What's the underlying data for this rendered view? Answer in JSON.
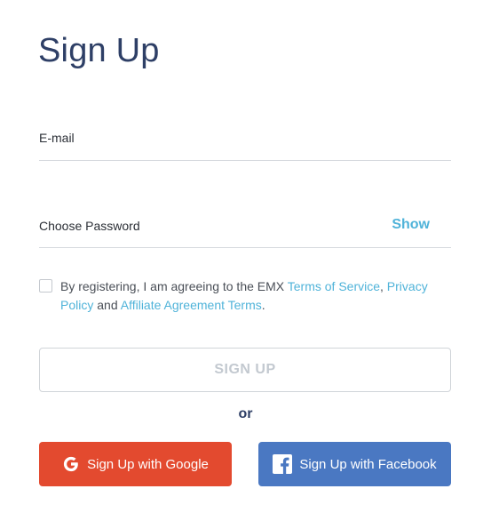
{
  "page": {
    "title": "Sign Up"
  },
  "form": {
    "email_label": "E-mail",
    "email_value": "",
    "password_label": "Choose Password",
    "password_value": "",
    "show_label": "Show"
  },
  "terms": {
    "checked": false,
    "prefix": "By registering, I am agreeing to the EMX ",
    "terms_link": "Terms of Service",
    "sep": ", ",
    "privacy_link": "Privacy Policy",
    "and": " and ",
    "affiliate_link": "Affiliate Agreement Terms",
    "suffix": "."
  },
  "actions": {
    "signup_label": "SIGN UP",
    "or_label": "or",
    "google_label": "Sign Up with Google",
    "google_icon": "google-g-icon",
    "facebook_label": "Sign Up with Facebook",
    "facebook_icon": "facebook-f-icon"
  },
  "colors": {
    "title": "#2e3f66",
    "link": "#4fb3d9",
    "google": "#e34a2f",
    "facebook": "#4a78c2",
    "disabled_text": "#c3c9d0"
  }
}
